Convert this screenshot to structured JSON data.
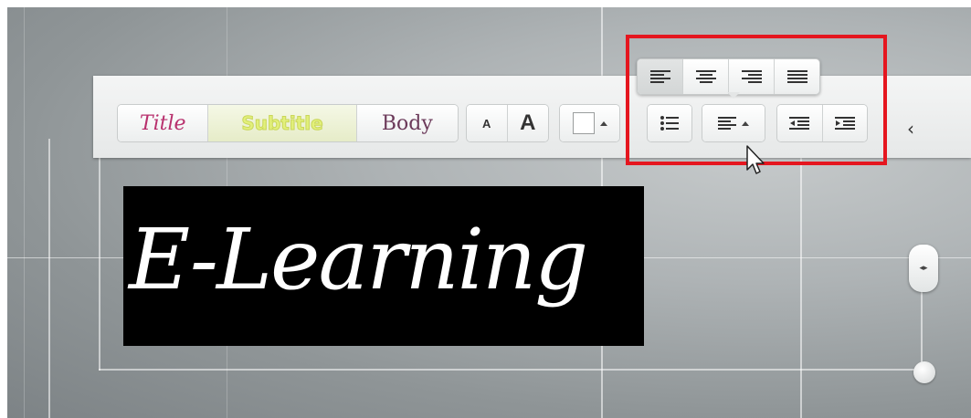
{
  "style_presets": {
    "title": "Title",
    "subtitle": "Subtitle",
    "body": "Body"
  },
  "font_size": {
    "decrease": "A",
    "increase": "A"
  },
  "color_swatch": {
    "color": "#ffffff"
  },
  "icons": {
    "list": "bulleted-list-icon",
    "align_menu": "align-left-dropdown-icon",
    "outdent": "decrease-indent-icon",
    "indent": "increase-indent-icon",
    "collapse": "chevron-left-icon",
    "slider": "left-right-arrows-icon"
  },
  "alignment_popup": {
    "options": [
      "align-left",
      "align-center",
      "align-right",
      "justify"
    ],
    "selected": "align-left"
  },
  "collapse_glyph": "‹",
  "slider_glyph": "◂▸",
  "textbox": {
    "text": "E-Learning"
  },
  "colors": {
    "highlight": "#e5161f",
    "title_text": "#b8306d",
    "subtitle_text": "#e2f07a",
    "body_text": "#6c3a5a",
    "textbox_bg": "#000000"
  }
}
